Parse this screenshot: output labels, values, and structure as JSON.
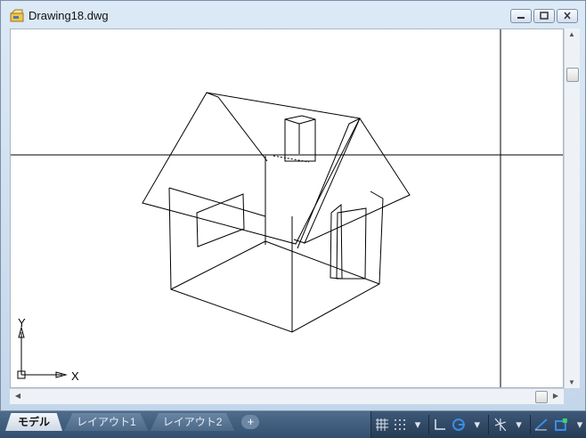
{
  "window": {
    "title": "Drawing18.dwg",
    "buttons": [
      "minimize",
      "maximize",
      "close"
    ]
  },
  "ucs": {
    "y_label": "Y",
    "x_label": "X"
  },
  "layout_tabs": [
    {
      "label": "モデル",
      "active": true
    },
    {
      "label": "レイアウト1",
      "active": false
    },
    {
      "label": "レイアウト2",
      "active": false
    }
  ],
  "add_tab_label": "+",
  "status_tools": [
    "grid-icon",
    "snap-icon",
    "dropdown-icon",
    "ortho-icon",
    "polar-icon",
    "dropdown-icon",
    "isodraft-icon",
    "dropdown-icon",
    "object-snap-tracking-icon",
    "object-snap-icon",
    "dropdown-icon"
  ],
  "colors": {
    "viewport_background": "#ffffff",
    "linework": "#000000",
    "titlebar": "#dce9f6",
    "statusbar": "#34506f",
    "polar_icon": "#3a8fe8"
  }
}
